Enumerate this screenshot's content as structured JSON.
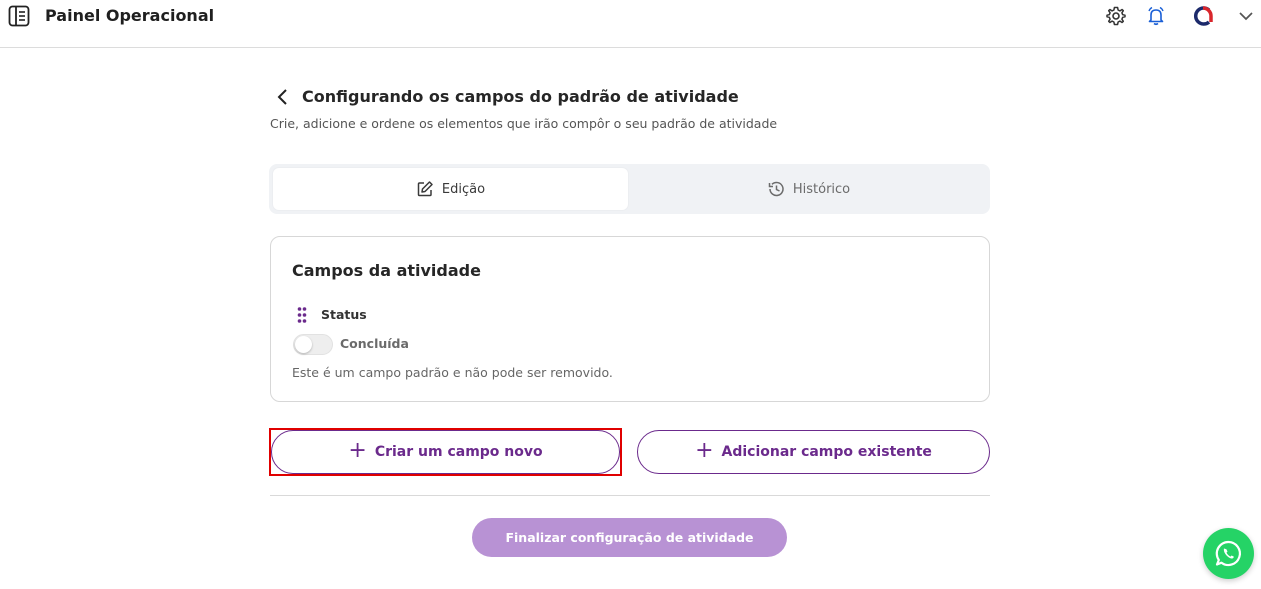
{
  "header": {
    "app_title": "Painel Operacional",
    "icons": [
      "sidebar-book-icon",
      "gear-icon",
      "bell-icon",
      "brand-logo-icon",
      "chevron-down-icon"
    ]
  },
  "page": {
    "title": "Configurando os campos do padrão de atividade",
    "subtitle": "Crie, adicione e ordene os elementos que irão compôr o seu padrão de atividade"
  },
  "tabs": [
    {
      "label": "Edição",
      "icon": "edit-icon",
      "active": true
    },
    {
      "label": "Histórico",
      "icon": "history-clock-icon",
      "active": false
    }
  ],
  "card": {
    "title": "Campos da atividade",
    "field": {
      "name": "Status",
      "toggle_label": "Concluída",
      "toggle_on": false,
      "note": "Este é um campo padrão e não pode ser removido."
    }
  },
  "actions": {
    "create_label": "Criar um campo novo",
    "add_existing_label": "Adicionar campo existente",
    "finish_label": "Finalizar configuração de atividade"
  },
  "colors": {
    "accent": "#6b2a8c",
    "finish_button": "#b892d4",
    "highlight": "#e00000",
    "whatsapp": "#25d366"
  }
}
